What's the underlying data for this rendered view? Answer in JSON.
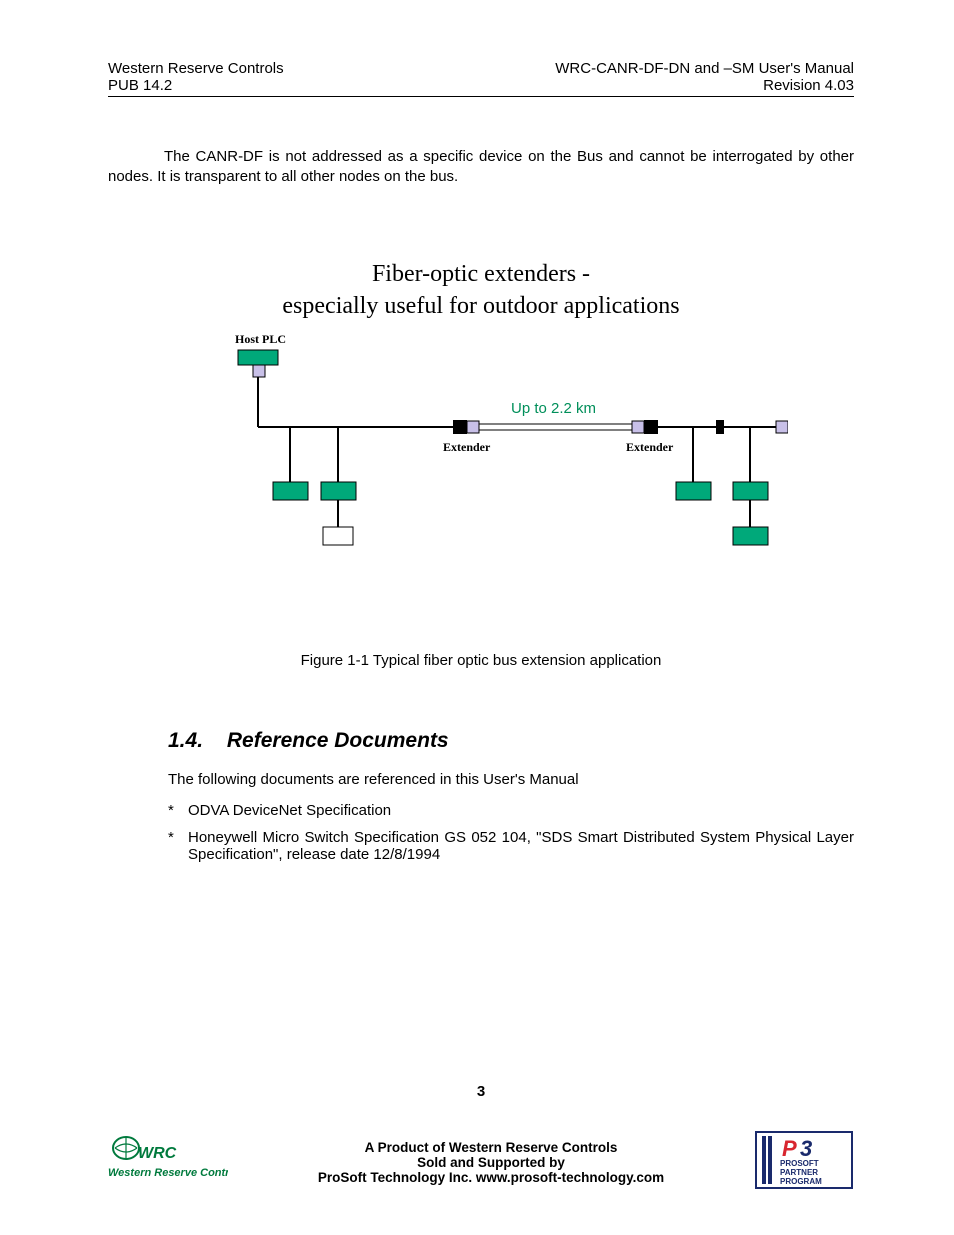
{
  "header": {
    "left_line1": "Western Reserve Controls",
    "left_line2": "PUB 14.2",
    "right_line1": "WRC-CANR-DF-DN and –SM User's Manual",
    "right_line2": "Revision 4.03"
  },
  "paragraph1": "The CANR-DF is not addressed as a specific device on the Bus and cannot be interrogated by other nodes. It is transparent to all other nodes on the bus.",
  "figure": {
    "heading_line1": "Fiber-optic extenders -",
    "heading_line2": "especially useful for outdoor applications",
    "label_host": "Host PLC",
    "label_distance": "Up to 2.2 km",
    "label_extender_left": "Extender",
    "label_extender_right": "Extender",
    "caption": "Figure 1-1 Typical fiber optic bus extension application"
  },
  "section": {
    "number": "1.4.",
    "title": "Reference Documents",
    "intro": "The following documents are referenced in this User's Manual",
    "refs": [
      "ODVA DeviceNet Specification",
      "Honeywell Micro Switch Specification GS 052 104, \"SDS Smart Distributed System Physical Layer Specification\", release date 12/8/1994"
    ]
  },
  "footer": {
    "page_number": "3",
    "line1": "A Product of Western Reserve Controls",
    "line2": "Sold and Supported by",
    "line3": "ProSoft Technology Inc. www.prosoft-technology.com",
    "logo_wrc_text1": "WRC",
    "logo_wrc_text2": "Western Reserve Controls",
    "logo_p3_text1": "P3",
    "logo_p3_text2": "PROSOFT",
    "logo_p3_text3": "PARTNER",
    "logo_p3_text4": "PROGRAM"
  },
  "colors": {
    "teal": "#00a97a",
    "green_text": "#008f5a",
    "wrc_green": "#007a3d",
    "p3_red": "#d8262f",
    "p3_blue": "#1a2a6c"
  }
}
